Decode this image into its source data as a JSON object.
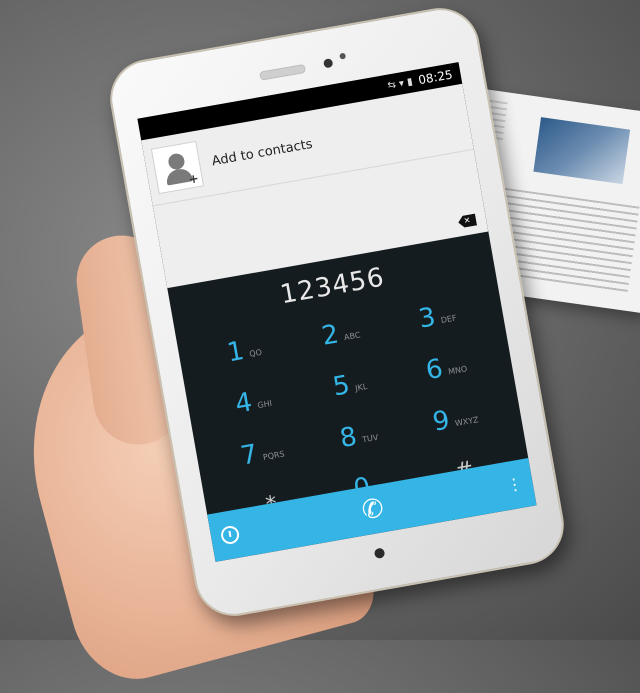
{
  "status_bar": {
    "time": "08:25",
    "icons": "⇆ ▾ ▮"
  },
  "contacts": {
    "add_label": "Add to contacts"
  },
  "dialer": {
    "number": "123456",
    "keys": [
      {
        "digit": "1",
        "letters": "QO"
      },
      {
        "digit": "2",
        "letters": "ABC"
      },
      {
        "digit": "3",
        "letters": "DEF"
      },
      {
        "digit": "4",
        "letters": "GHI"
      },
      {
        "digit": "5",
        "letters": "JKL"
      },
      {
        "digit": "6",
        "letters": "MNO"
      },
      {
        "digit": "7",
        "letters": "PQRS"
      },
      {
        "digit": "8",
        "letters": "TUV"
      },
      {
        "digit": "9",
        "letters": "WXYZ"
      },
      {
        "digit": "*",
        "letters": ""
      },
      {
        "digit": "0",
        "letters": "+"
      },
      {
        "digit": "#",
        "letters": ""
      }
    ]
  },
  "icons": {
    "call": "phone-icon",
    "history": "clock-icon",
    "overflow": "overflow-menu-icon",
    "backspace": "backspace-icon",
    "avatar": "add-contact-avatar-icon"
  },
  "colors": {
    "accent": "#34b5e5",
    "screen_bg": "#151c20"
  }
}
